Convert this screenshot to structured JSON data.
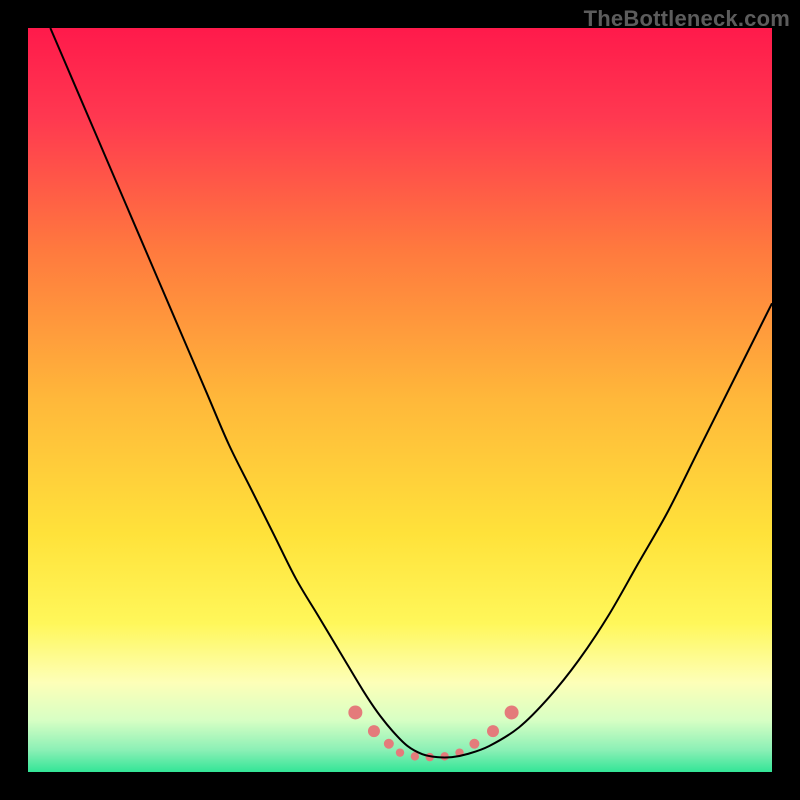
{
  "watermark": "TheBottleneck.com",
  "chart_data": {
    "type": "line",
    "title": "",
    "xlabel": "",
    "ylabel": "",
    "xlim": [
      0,
      100
    ],
    "ylim": [
      0,
      100
    ],
    "background_gradient": {
      "stops": [
        {
          "pos": 0.0,
          "color": "#ff1a4b"
        },
        {
          "pos": 0.12,
          "color": "#ff3850"
        },
        {
          "pos": 0.3,
          "color": "#ff7a3e"
        },
        {
          "pos": 0.5,
          "color": "#ffb83a"
        },
        {
          "pos": 0.68,
          "color": "#ffe23a"
        },
        {
          "pos": 0.8,
          "color": "#fff75a"
        },
        {
          "pos": 0.88,
          "color": "#fdffb8"
        },
        {
          "pos": 0.93,
          "color": "#d8ffc4"
        },
        {
          "pos": 0.97,
          "color": "#8cf0b6"
        },
        {
          "pos": 1.0,
          "color": "#33e597"
        }
      ]
    },
    "series": [
      {
        "name": "bottleneck-curve",
        "color": "#000000",
        "width": 2,
        "x": [
          3,
          6,
          9,
          12,
          15,
          18,
          21,
          24,
          27,
          30,
          33,
          36,
          39,
          42,
          45,
          47,
          49,
          51,
          53,
          55,
          57,
          59,
          62,
          66,
          70,
          74,
          78,
          82,
          86,
          90,
          94,
          98,
          100
        ],
        "y": [
          100,
          93,
          86,
          79,
          72,
          65,
          58,
          51,
          44,
          38,
          32,
          26,
          21,
          16,
          11,
          8,
          5.5,
          3.5,
          2.4,
          2.0,
          2.0,
          2.4,
          3.5,
          6,
          10,
          15,
          21,
          28,
          35,
          43,
          51,
          59,
          63
        ]
      }
    ],
    "markers": {
      "name": "bottom-beads",
      "color": "#e47b7b",
      "radius_seq": [
        7,
        6,
        5,
        4.2,
        4.2,
        4.2,
        4.2,
        4.2,
        5,
        6,
        7
      ],
      "x": [
        44,
        46.5,
        48.5,
        50,
        52,
        54,
        56,
        58,
        60,
        62.5,
        65
      ],
      "y": [
        8.0,
        5.5,
        3.8,
        2.6,
        2.1,
        2.0,
        2.1,
        2.6,
        3.8,
        5.5,
        8.0
      ]
    }
  }
}
